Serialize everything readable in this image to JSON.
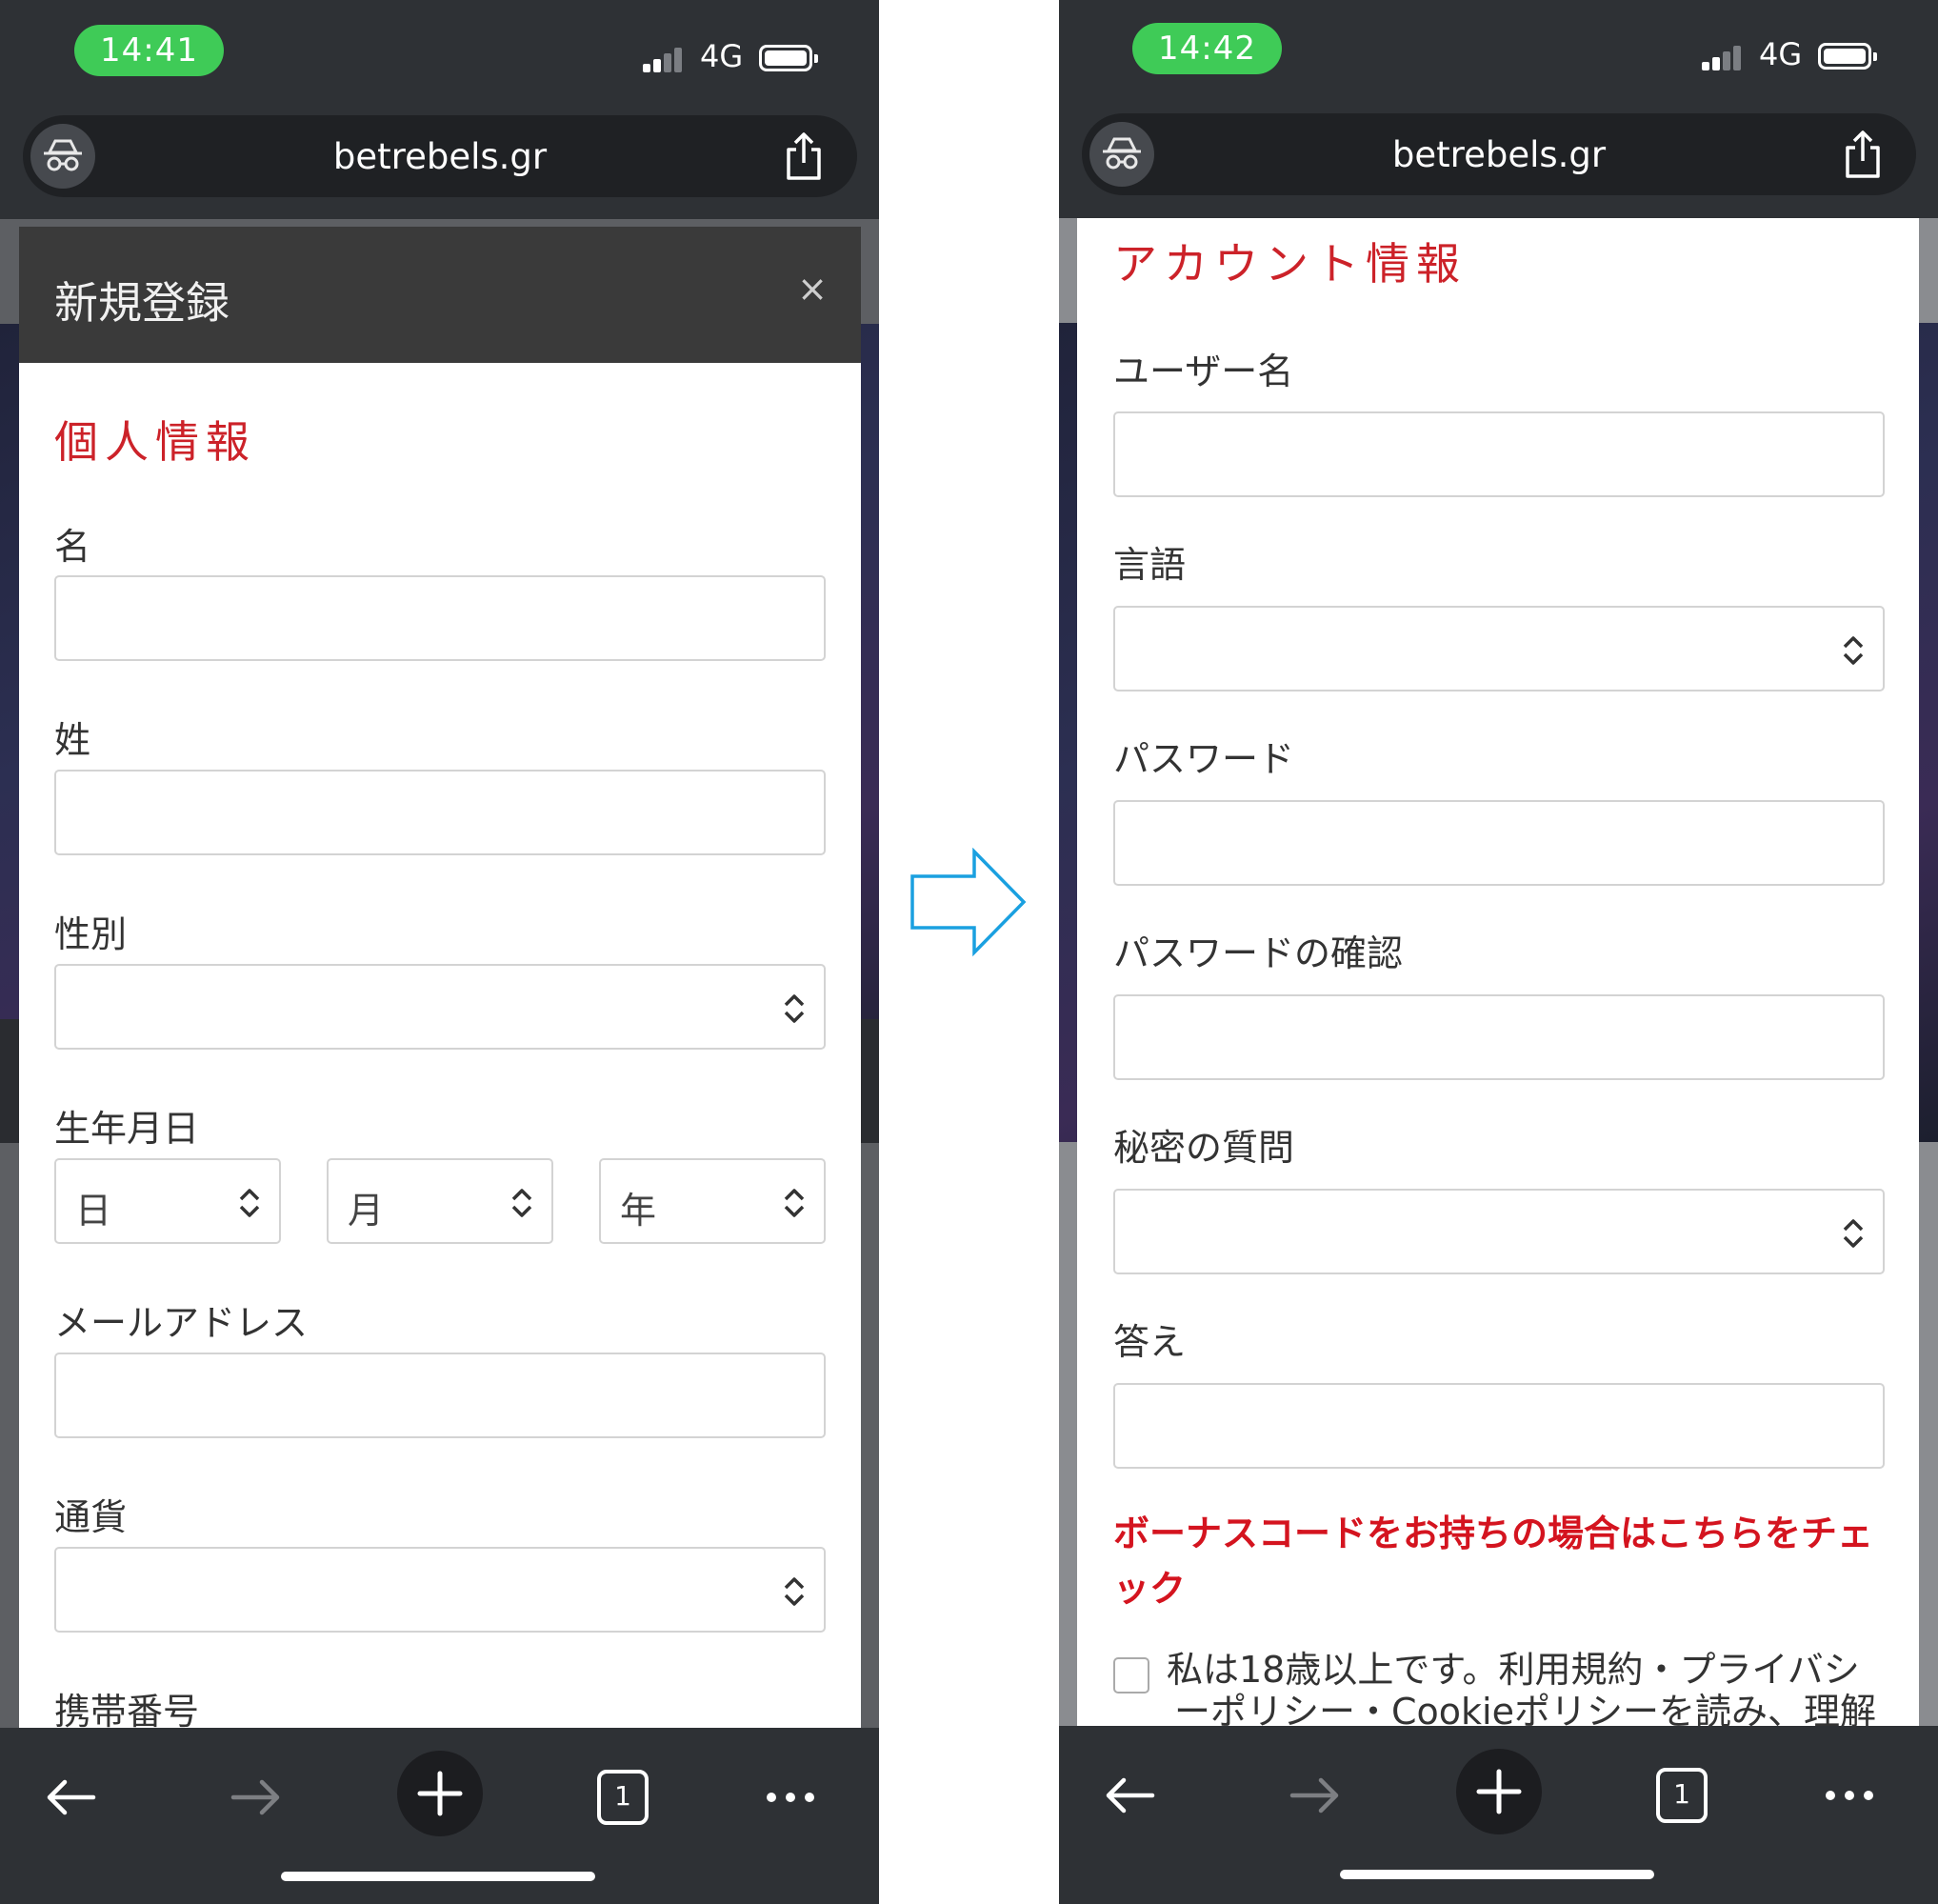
{
  "left": {
    "status": {
      "time": "14:41",
      "network": "4G"
    },
    "browser": {
      "url": "betrebels.gr"
    },
    "modal": {
      "title": "新規登録",
      "close": "×"
    },
    "section_title": "個人情報",
    "fields": {
      "first_name": "名",
      "last_name": "姓",
      "gender": "性別",
      "birthdate": "生年月日",
      "day": "日",
      "month": "月",
      "year": "年",
      "email": "メールアドレス",
      "currency": "通貨",
      "mobile": "携帯番号"
    }
  },
  "right": {
    "status": {
      "time": "14:42",
      "network": "4G"
    },
    "browser": {
      "url": "betrebels.gr"
    },
    "section_title": "アカウント情報",
    "fields": {
      "username": "ユーザー名",
      "language": "言語",
      "password": "パスワード",
      "password_confirm": "パスワードの確認",
      "secret_question": "秘密の質問",
      "answer": "答え"
    },
    "bonus_link_line1": "ボーナスコードをお持ちの場合はこちらをチェ",
    "bonus_link_line2": "ック",
    "terms_line1": "私は18歳以上です。利用規約・プライバシ",
    "terms_line2": "ーポリシー・Cookieポリシーを読み、理解"
  },
  "toolbar": {
    "tab_count": "1"
  },
  "colors": {
    "accent_red": "#cc2229",
    "status_green": "#3fcb57",
    "arrow_blue": "#1aa0e0"
  }
}
